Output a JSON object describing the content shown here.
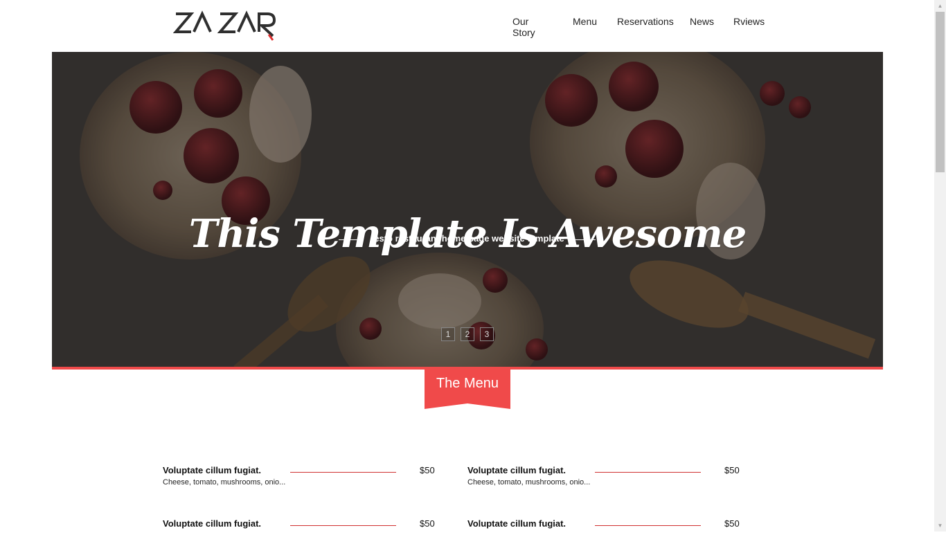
{
  "header": {
    "logo_text": "ZA ZAR",
    "nav": [
      "Our Story",
      "Menu",
      "Reservations",
      "News",
      "Rviews"
    ]
  },
  "hero": {
    "title": "This Template Is Awesome",
    "subtitle": "resto restaurant home page website template",
    "pages": [
      "1",
      "2",
      "3"
    ]
  },
  "section": {
    "title": "The Menu"
  },
  "menu_items": [
    {
      "name": "Voluptate cillum fugiat.",
      "desc": "Cheese, tomato, mushrooms, onio...",
      "price": "$50"
    },
    {
      "name": "Voluptate cillum fugiat.",
      "desc": "Cheese, tomato, mushrooms, onio...",
      "price": "$50"
    },
    {
      "name": "Voluptate cillum fugiat.",
      "desc": "",
      "price": "$50"
    },
    {
      "name": "Voluptate cillum fugiat.",
      "desc": "",
      "price": "$50"
    }
  ],
  "colors": {
    "accent": "#f04a4a",
    "line": "#d03030"
  }
}
